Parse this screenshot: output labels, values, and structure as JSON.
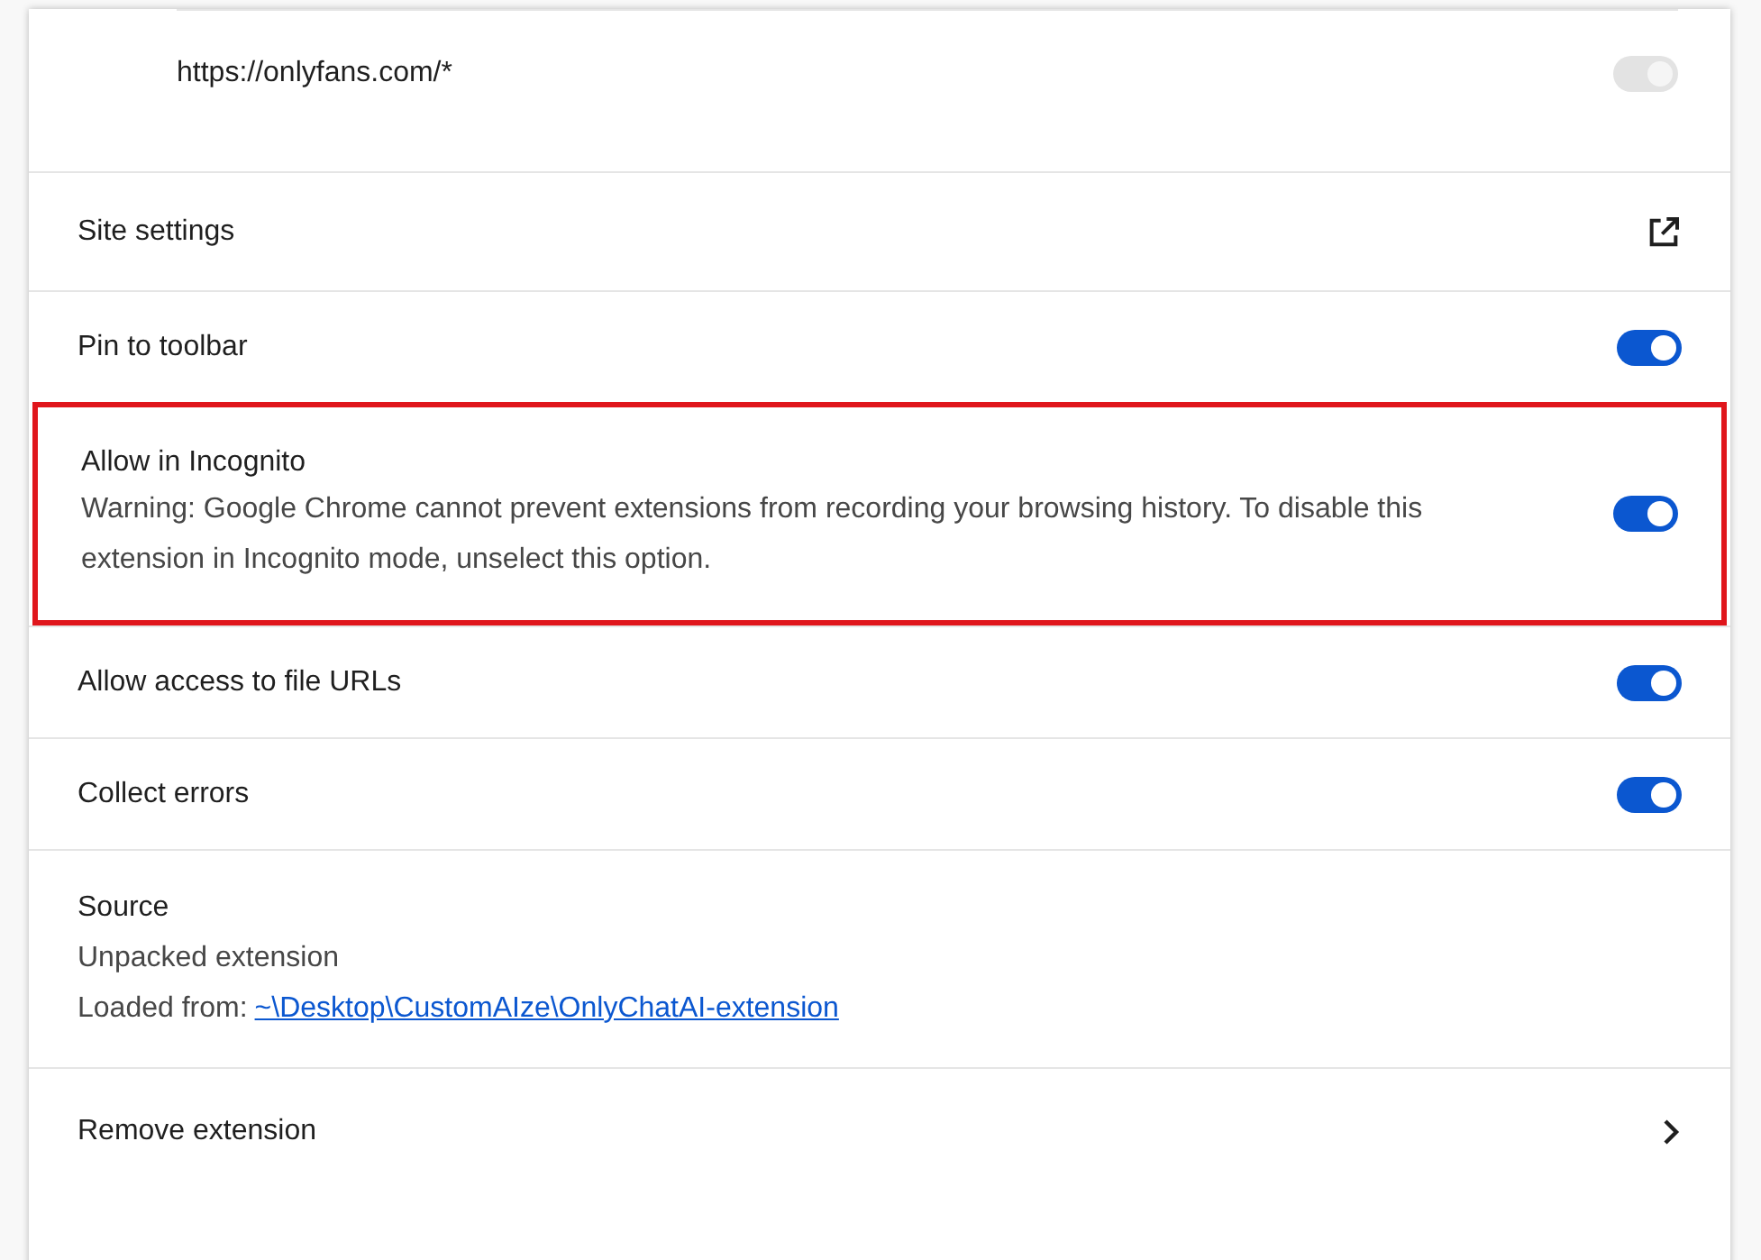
{
  "site_access": {
    "url": "https://onlyfans.com/*",
    "on": true,
    "disabled": true
  },
  "rows": [
    {
      "kind": "link",
      "label": "Site settings",
      "highlighted": false
    },
    {
      "kind": "toggle",
      "label": "Pin to toolbar",
      "on": true,
      "highlighted": false
    },
    {
      "kind": "toggle",
      "label": "Allow in Incognito",
      "description": "Warning: Google Chrome cannot prevent extensions from recording your browsing history. To disable this extension in Incognito mode, unselect this option.",
      "on": true,
      "highlighted": true
    },
    {
      "kind": "toggle",
      "label": "Allow access to file URLs",
      "on": true,
      "highlighted": false
    },
    {
      "kind": "toggle",
      "label": "Collect errors",
      "on": true,
      "highlighted": false
    },
    {
      "kind": "source",
      "label": "Source",
      "type": "Unpacked extension",
      "loaded_label": "Loaded from:",
      "path": "~\\Desktop\\CustomAIze\\OnlyChatAI-extension",
      "highlighted": false
    },
    {
      "kind": "nav",
      "label": "Remove extension",
      "highlighted": false
    }
  ]
}
